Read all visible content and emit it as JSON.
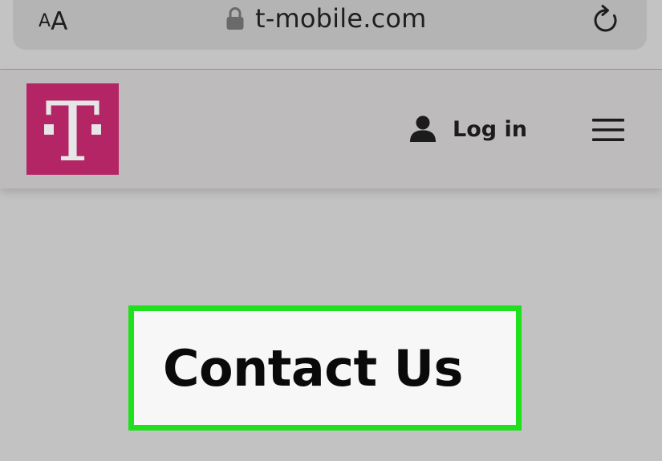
{
  "browser": {
    "text_size_small": "A",
    "text_size_large": "A",
    "url": "t-mobile.com",
    "icons": {
      "lock": "lock-icon",
      "reload": "reload-icon"
    }
  },
  "header": {
    "logo_letter": "T",
    "login_label": "Log in",
    "icons": {
      "user": "person-icon",
      "menu": "hamburger-menu-icon"
    }
  },
  "main": {
    "contact_title": "Contact Us"
  },
  "colors": {
    "brand_magenta": "#b42565",
    "highlight_green": "#1fe01c",
    "page_background": "#c2c2c2"
  }
}
